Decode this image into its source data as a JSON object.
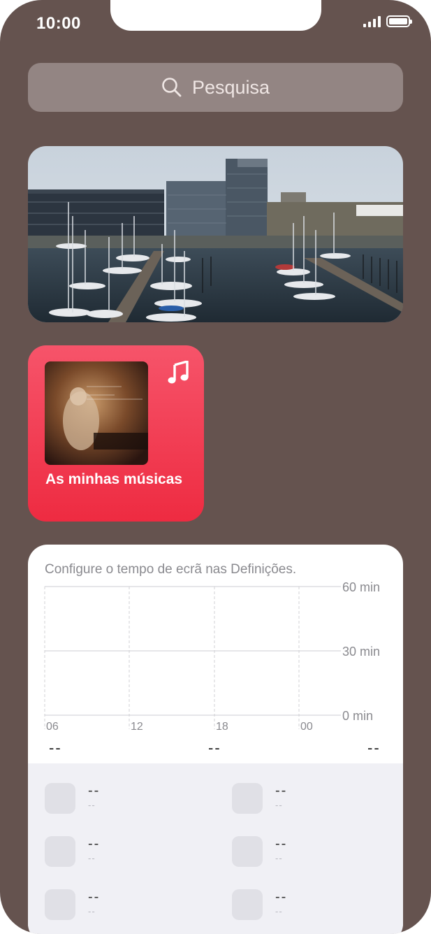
{
  "status_bar": {
    "time": "10:00"
  },
  "search": {
    "label": "Pesquisa"
  },
  "music_widget": {
    "title": "As minhas músicas"
  },
  "screen_time": {
    "note": "Configure o tempo de ecrã nas Definições.",
    "y_ticks": [
      "60 min",
      "30 min",
      "0 min"
    ],
    "x_ticks": [
      "06",
      "12",
      "18",
      "00"
    ],
    "summary": [
      "--",
      "--",
      "--"
    ],
    "apps": [
      {
        "main": "--",
        "sub": "--"
      },
      {
        "main": "--",
        "sub": "--"
      },
      {
        "main": "--",
        "sub": "--"
      },
      {
        "main": "--",
        "sub": "--"
      },
      {
        "main": "--",
        "sub": "--"
      },
      {
        "main": "--",
        "sub": "--"
      }
    ]
  },
  "colors": {
    "wallpaper": "#65534f",
    "music_accent": "#ef3349",
    "search_bg": "#938583"
  }
}
